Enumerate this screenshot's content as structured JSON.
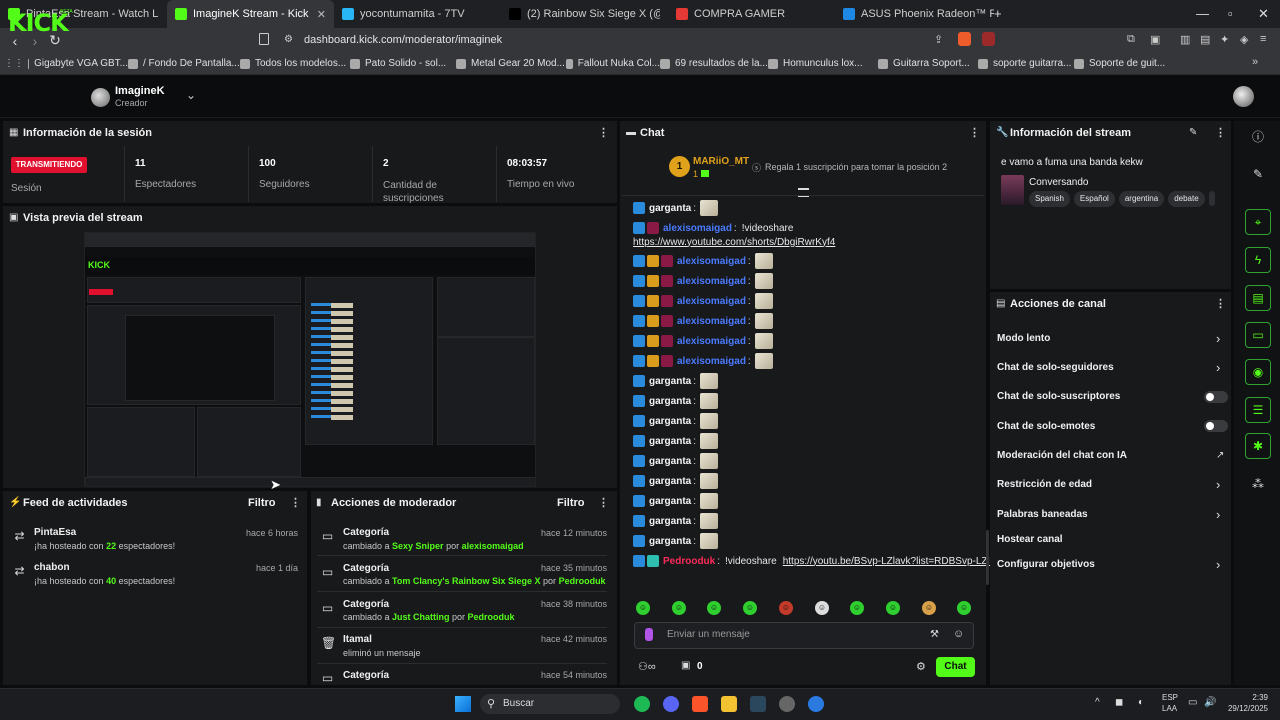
{
  "browser": {
    "tabs": [
      {
        "label": "PintaEsa Stream - Watch Live on",
        "color": "#53fc18"
      },
      {
        "label": "ImagineK Stream - Kick Dashb",
        "color": "#53fc18",
        "active": true
      },
      {
        "label": "yocontumamita - 7TV",
        "color": "#29b6f6"
      },
      {
        "label": "(2) Rainbow Six Siege X (@Rainbow6",
        "color": "#000000"
      },
      {
        "label": "COMPRA GAMER",
        "color": "#e53935"
      },
      {
        "label": "ASUS Phoenix Radeon™ RX 6400 4GB",
        "color": "#1e88e5"
      }
    ],
    "url": "dashboard.kick.com/moderator/imaginek",
    "bookmarks": [
      "Gigabyte VGA GBT...",
      "/ Fondo De Pantalla...",
      "Todos los modelos...",
      "Pato Solido - sol...",
      "Metal Gear 20 Mod...",
      "Fallout Nuka Col...",
      "69 resultados de la...",
      "Homunculus lox...",
      "Guitarra Soport...",
      "soporte guitarra...",
      "Soporte de guit..."
    ]
  },
  "header": {
    "logo": "KICK",
    "beta": "BETA",
    "user_name": "ImagineK",
    "user_role": "Creador"
  },
  "session": {
    "title": "Información de la sesión",
    "live_badge": "TRANSMITIENDO",
    "status_label": "Sesión",
    "stats": [
      {
        "value": "11",
        "label": "Espectadores"
      },
      {
        "value": "100",
        "label": "Seguidores"
      },
      {
        "value": "2",
        "label": "Cantidad de suscripciones"
      },
      {
        "value": "08:03:57",
        "label": "Tiempo en vivo"
      }
    ]
  },
  "preview": {
    "title": "Vista previa del stream"
  },
  "activity_feed": {
    "title": "Feed de actividades",
    "filter": "Filtro",
    "items": [
      {
        "name": "PintaEsa",
        "pre": "¡ha hosteado con ",
        "count": "22",
        "post": " espectadores!",
        "time": "hace 6 horas"
      },
      {
        "name": "chabon",
        "pre": "¡ha hosteado con ",
        "count": "40",
        "post": " espectadores!",
        "time": "hace 1 día"
      }
    ]
  },
  "mod_actions": {
    "title": "Acciones de moderador",
    "filter": "Filtro",
    "items": [
      {
        "title": "Categoría",
        "pre": "cambiado a ",
        "target": "Sexy Sniper",
        "mid": " por ",
        "by": "alexisomaigad",
        "time": "hace 12 minutos"
      },
      {
        "title": "Categoría",
        "pre": "cambiado a ",
        "target": "Tom Clancy's Rainbow Six Siege X",
        "mid": " por ",
        "by": "Pedrooduk",
        "time": "hace 35 minutos"
      },
      {
        "title": "Categoría",
        "pre": "cambiado a ",
        "target": "Just Chatting",
        "mid": " por ",
        "by": "Pedrooduk",
        "time": "hace 38 minutos"
      },
      {
        "title": "Itamal",
        "pre": "eliminó un mensaje",
        "target": "",
        "mid": "",
        "by": "",
        "time": "hace 42 minutos"
      },
      {
        "title": "Categoría",
        "pre": "",
        "target": "",
        "mid": "",
        "by": "",
        "time": "hace 54 minutos"
      }
    ]
  },
  "chat": {
    "title": "Chat",
    "top_gifter": {
      "name": "MARiiO_MT",
      "rank": "1",
      "count": "1",
      "message": "Regala 1 suscripción para tomar la posición 2"
    },
    "messages": [
      {
        "user": "garganta",
        "color": "white",
        "badges": [
          "blue"
        ],
        "text": "",
        "emote": true
      },
      {
        "user": "alexisomaigad",
        "color": "blue",
        "badges": [
          "blue",
          "pink"
        ],
        "text": "!videoshare",
        "emote": false
      },
      {
        "user": "",
        "color": "",
        "badges": [],
        "text": "https://www.youtube.com/shorts/DbgiRwrKyf4",
        "emote": false,
        "link": true
      },
      {
        "user": "alexisomaigad",
        "color": "blue",
        "badges": [
          "blue",
          "gold",
          "pink"
        ],
        "text": "",
        "emote": true
      },
      {
        "user": "alexisomaigad",
        "color": "blue",
        "badges": [
          "blue",
          "gold",
          "pink"
        ],
        "text": "",
        "emote": true
      },
      {
        "user": "alexisomaigad",
        "color": "blue",
        "badges": [
          "blue",
          "gold",
          "pink"
        ],
        "text": "",
        "emote": true
      },
      {
        "user": "alexisomaigad",
        "color": "blue",
        "badges": [
          "blue",
          "gold",
          "pink"
        ],
        "text": "",
        "emote": true
      },
      {
        "user": "alexisomaigad",
        "color": "blue",
        "badges": [
          "blue",
          "gold",
          "pink"
        ],
        "text": "",
        "emote": true
      },
      {
        "user": "alexisomaigad",
        "color": "blue",
        "badges": [
          "blue",
          "gold",
          "pink"
        ],
        "text": "",
        "emote": true
      },
      {
        "user": "garganta",
        "color": "white",
        "badges": [
          "blue"
        ],
        "text": "",
        "emote": true
      },
      {
        "user": "garganta",
        "color": "white",
        "badges": [
          "blue"
        ],
        "text": "",
        "emote": true
      },
      {
        "user": "garganta",
        "color": "white",
        "badges": [
          "blue"
        ],
        "text": "",
        "emote": true
      },
      {
        "user": "garganta",
        "color": "white",
        "badges": [
          "blue"
        ],
        "text": "",
        "emote": true
      },
      {
        "user": "garganta",
        "color": "white",
        "badges": [
          "blue"
        ],
        "text": "",
        "emote": true
      },
      {
        "user": "garganta",
        "color": "white",
        "badges": [
          "blue"
        ],
        "text": "",
        "emote": true
      },
      {
        "user": "garganta",
        "color": "white",
        "badges": [
          "blue"
        ],
        "text": "",
        "emote": true
      },
      {
        "user": "garganta",
        "color": "white",
        "badges": [
          "blue"
        ],
        "text": "",
        "emote": true
      },
      {
        "user": "garganta",
        "color": "white",
        "badges": [
          "blue"
        ],
        "text": "",
        "emote": true
      },
      {
        "user": "Pedrooduk",
        "color": "pink",
        "badges": [
          "blue",
          "teal"
        ],
        "text": "!videoshare",
        "link_text": "https://youtu.be/BSvp-LZlavk?list=RDBSvp-LZlavk",
        "emote": false
      }
    ],
    "input_placeholder": "Enviar un mensaje",
    "points": "0",
    "send_label": "Chat"
  },
  "stream_info": {
    "title": "Información del stream",
    "stream_title": "e vamo a fuma una banda kekw",
    "category": "Conversando",
    "tags": [
      "Spanish",
      "Español",
      "argentina",
      "debate"
    ]
  },
  "channel_actions": {
    "title": "Acciones de canal",
    "items": [
      {
        "label": "Modo lento",
        "control": "arrow"
      },
      {
        "label": "Chat de solo-seguidores",
        "control": "arrow"
      },
      {
        "label": "Chat de solo-suscriptores",
        "control": "toggle"
      },
      {
        "label": "Chat de solo-emotes",
        "control": "toggle"
      },
      {
        "label": "Moderación del chat con IA",
        "control": "external"
      },
      {
        "label": "Restricción de edad",
        "control": "arrow"
      },
      {
        "label": "Palabras baneadas",
        "control": "arrow"
      },
      {
        "label": "Hostear canal",
        "control": "none"
      },
      {
        "label": "Configurar objetivos",
        "control": "arrow"
      }
    ]
  },
  "taskbar": {
    "search": "Buscar",
    "lang": "ESP",
    "region": "LAA",
    "time": "2:39",
    "date": "29/12/2025"
  }
}
